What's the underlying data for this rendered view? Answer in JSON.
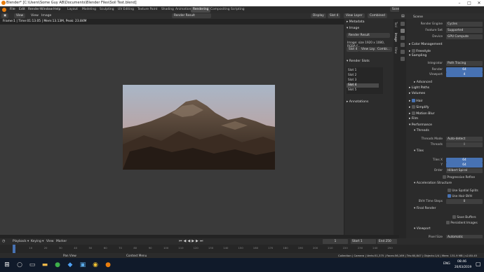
{
  "window": {
    "title": "Blender* [C:\\Users\\Some Guy AB\\Documents\\Blender Files\\Soil Test.blend]"
  },
  "menu": {
    "file": "File",
    "edit": "Edit",
    "render": "Render",
    "window": "Window",
    "help": "Help"
  },
  "workspaces": [
    "Layout",
    "Modeling",
    "Sculpting",
    "UV Editing",
    "Texture Paint",
    "Shading",
    "Animation",
    "Rendering",
    "Compositing",
    "Scripting"
  ],
  "scene": {
    "label": "Scene",
    "view_layer": "View Layer"
  },
  "image_editor": {
    "view_mode": "View",
    "view": "View",
    "image": "Image",
    "image_name": "Render Result",
    "display": "Display",
    "slot": "Slot 4",
    "layer": "View Layer",
    "pass": "Combined",
    "status": "Frame:1 | Time:01:13.05 | Mem:13.13M, Peak: 23.84M"
  },
  "sidebar": {
    "metadata": "Metadata",
    "image": "Image",
    "image_name": "Render Result",
    "image_info": "Image: size 1920 x 1080, RGBA f...",
    "slot": "Slot 4",
    "layer": "View Lay...",
    "pass": "Combi...",
    "render_slots": "Render Slots",
    "slots": [
      "Slot 1",
      "Slot 2",
      "Slot 3",
      "Slot 4",
      "Slot 5"
    ],
    "annotations": "Annotations",
    "tabs": [
      "Tool",
      "Image",
      "View"
    ]
  },
  "properties": {
    "scene": "Scene",
    "render_engine_label": "Render Engine",
    "render_engine": "Cycles",
    "feature_set_label": "Feature Set",
    "feature_set": "Supported",
    "device_label": "Device",
    "device": "GPU Compute",
    "color_management": "Color Management",
    "freestyle": "Freestyle",
    "sampling": "Sampling",
    "integrator_label": "Integrator",
    "integrator": "Path Tracing",
    "render_label": "Render",
    "render_samples": "64",
    "viewport_label": "Viewport",
    "viewport_samples": "4",
    "advanced": "Advanced",
    "light_paths": "Light Paths",
    "volumes": "Volumes",
    "hair": "Hair",
    "simplify": "Simplify",
    "motion_blur": "Motion Blur",
    "film": "Film",
    "performance": "Performance",
    "threads": "Threads",
    "threads_mode_label": "Threads Mode",
    "threads_mode": "Auto-detect",
    "threads_label": "Threads",
    "threads_value": "8",
    "tiles": "Tiles",
    "tiles_x_label": "Tiles X",
    "tiles_x": "64",
    "tiles_y_label": "Y",
    "tiles_y": "64",
    "order_label": "Order",
    "order": "Hilbert Spiral",
    "progressive_refine": "Progressive Refine",
    "acceleration": "Acceleration Structure",
    "spatial_splits": "Use Spatial Splits",
    "hair_bvh": "Use Hair BVH",
    "bvh_steps_label": "BVH Time Steps",
    "bvh_steps": "0",
    "final_render": "Final Render",
    "save_buffers": "Save Buffers",
    "persistent_images": "Persistent Images",
    "viewport": "Viewport",
    "pixel_size_label": "Pixel Size",
    "pixel_size": "Automatic",
    "start_pixels_label": "Start Pixels",
    "start_pixels": "64 px",
    "bake": "Bake"
  },
  "timeline": {
    "playback": "Playback",
    "keying": "Keying",
    "view": "View",
    "marker": "Marker",
    "current": "1",
    "start_label": "Start",
    "start": "1",
    "end_label": "End",
    "end": "250",
    "ticks": [
      "0",
      "10",
      "20",
      "30",
      "40",
      "50",
      "60",
      "70",
      "80",
      "90",
      "100",
      "110",
      "120",
      "130",
      "140",
      "150",
      "160",
      "170",
      "180",
      "190",
      "200",
      "210",
      "220",
      "230",
      "240",
      "250"
    ]
  },
  "statusbar": {
    "pan": "Pan View",
    "context": "Context Menu",
    "stats": "Collection | Camera | Verts:51,375 | Faces:56,169 | Tris:60,847 | Objects:1/4 | Mem: 131.9 MB | v2.80.45"
  },
  "taskbar": {
    "lang": "ENG",
    "time": "08:46",
    "date": "20/03/2019"
  }
}
